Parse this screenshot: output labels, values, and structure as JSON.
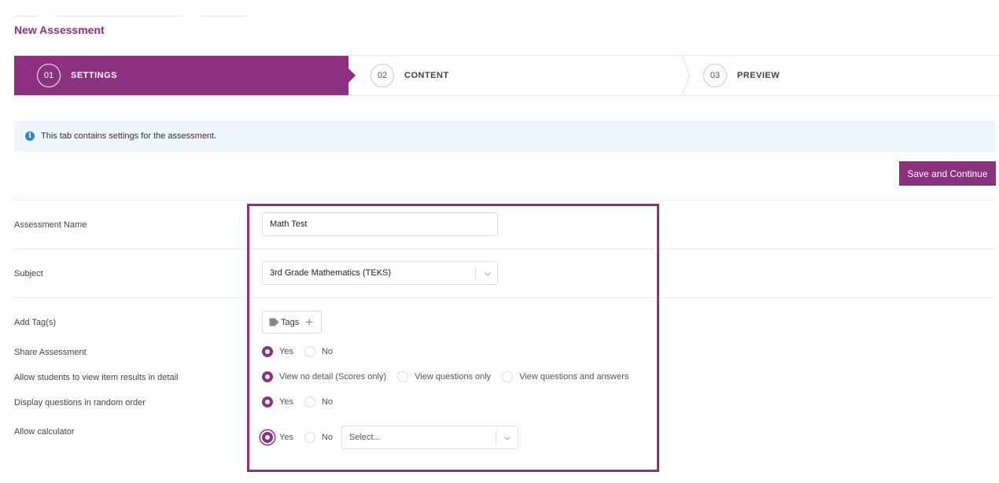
{
  "page": {
    "title": "New Assessment"
  },
  "stepper": {
    "steps": [
      {
        "num": "01",
        "label": "SETTINGS",
        "active": true
      },
      {
        "num": "02",
        "label": "CONTENT",
        "active": false
      },
      {
        "num": "03",
        "label": "PREVIEW",
        "active": false
      }
    ]
  },
  "info": {
    "icon": "info-icon",
    "text": "This tab contains settings for the assessment."
  },
  "toolbar": {
    "save_label": "Save and Continue"
  },
  "form": {
    "assessment_name": {
      "label": "Assessment Name",
      "value": "Math Test"
    },
    "subject": {
      "label": "Subject",
      "value": "3rd Grade Mathematics (TEKS)"
    },
    "tags": {
      "label": "Add Tag(s)",
      "button": "Tags"
    },
    "share": {
      "label": "Share Assessment",
      "options": [
        "Yes",
        "No"
      ],
      "selected": "Yes"
    },
    "view_results": {
      "label": "Allow students to view item results in detail",
      "options": [
        "View no detail (Scores only)",
        "View questions only",
        "View questions and answers"
      ],
      "selected": "View no detail (Scores only)"
    },
    "random_order": {
      "label": "Display questions in random order",
      "options": [
        "Yes",
        "No"
      ],
      "selected": "Yes"
    },
    "calculator": {
      "label": "Allow calculator",
      "options": [
        "Yes",
        "No"
      ],
      "selected": "Yes",
      "select_placeholder": "Select..."
    }
  },
  "colors": {
    "accent": "#8b3180",
    "info_bg": "#eef5fc",
    "info_icon": "#2b87d1"
  }
}
